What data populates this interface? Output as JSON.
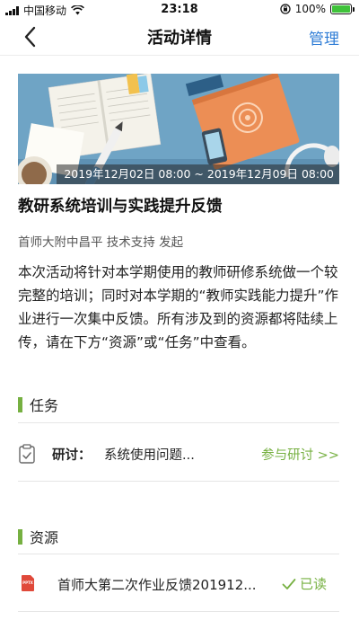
{
  "status_bar": {
    "carrier": "中国移动",
    "time": "23:18",
    "battery": "100%"
  },
  "nav": {
    "title": "活动详情",
    "manage": "管理"
  },
  "banner": {
    "date_range": "2019年12月02日 08:00 ~ 2019年12月09日 08:00"
  },
  "activity": {
    "title": "教研系统培训与实践提升反馈",
    "organizer": "首师大附中昌平 技术支持 发起",
    "description": "本次活动将针对本学期使用的教师研修系统做一个较完整的培训；同时对本学期的“教师实践能力提升”作业进行一次集中反馈。所有涉及到的资源都将陆续上传，请在下方“资源”或“任务”中查看。"
  },
  "tasks": {
    "heading": "任务",
    "items": [
      {
        "type": "研讨：",
        "text": "系统使用问题...",
        "action": "参与研讨 >>"
      }
    ]
  },
  "resources": {
    "heading": "资源",
    "items": [
      {
        "file_type": "PPTX",
        "name": "首师大第二次作业反馈201912...",
        "status": "已读"
      }
    ]
  },
  "colors": {
    "accent_green": "#76b041",
    "link_blue": "#2f7dd6",
    "file_red": "#e0493a"
  }
}
